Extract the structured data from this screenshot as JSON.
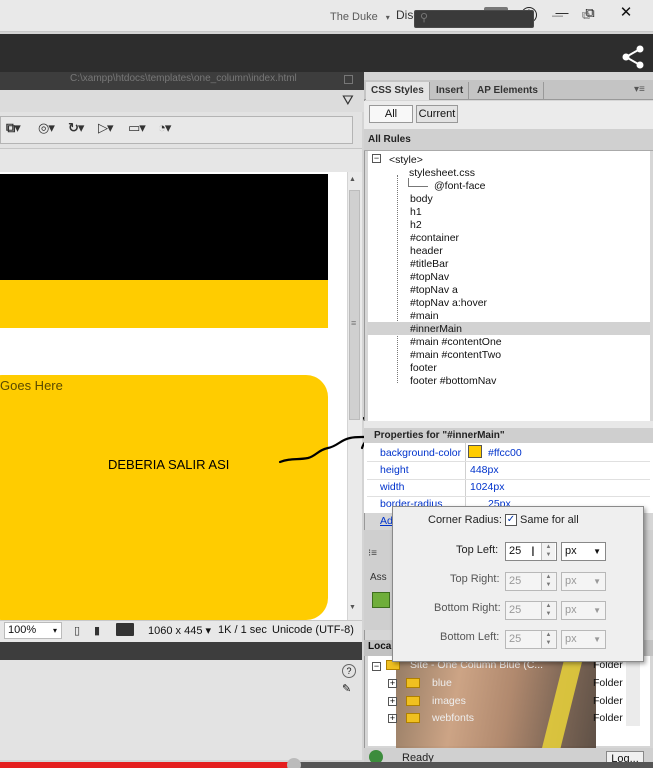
{
  "os_bar": {
    "workspace": "Diseño",
    "info_glyph": "i",
    "min_glyph": "—",
    "max_glyph": "⧉",
    "close_glyph": "✕",
    "sync_glyph": "⇆"
  },
  "app_bar": {
    "user": "The Duke"
  },
  "document": {
    "path": "C:\\xampp\\htdocs\\templates\\one_column\\index.html"
  },
  "design_view": {
    "placeholder_text": "Goes Here"
  },
  "status_bar": {
    "zoom": "100%",
    "window_size": "1060 x 445",
    "download": "1K / 1 sec",
    "encoding": "Unicode (UTF-8)"
  },
  "annotation": "DEBERIA SALIR ASI",
  "panel": {
    "tabs": [
      "CSS Styles",
      "Insert",
      "AP Elements"
    ],
    "buttons": {
      "all": "All",
      "current": "Current"
    },
    "section_label": "All Rules",
    "rules": [
      "<style>",
      "stylesheet.css",
      "@font-face",
      "body",
      "h1",
      "h2",
      "#container",
      "header",
      "#titleBar",
      "#topNav",
      "#topNav a",
      "#topNav a:hover",
      "#main",
      "#innerMain",
      "#main #contentOne",
      "#main #contentTwo",
      "footer",
      "footer #bottomNav"
    ],
    "selected_rule": "#innerMain",
    "properties_title": "Properties for \"#innerMain\"",
    "properties": [
      {
        "name": "background-color",
        "value": "#ffcc00"
      },
      {
        "name": "height",
        "value": "448px"
      },
      {
        "name": "width",
        "value": "1024px"
      },
      {
        "name": "border-radius",
        "value": "25px"
      }
    ],
    "add_property": "Add Property",
    "assets_label": "Ass"
  },
  "corner_radius_popup": {
    "title": "Corner Radius:",
    "same_for_all": "Same for all",
    "same_checked": true,
    "rows": [
      {
        "label": "Top Left:",
        "value": "25",
        "unit": "px",
        "enabled": true
      },
      {
        "label": "Top Right:",
        "value": "25",
        "unit": "px",
        "enabled": false
      },
      {
        "label": "Bottom Right:",
        "value": "25",
        "unit": "px",
        "enabled": false
      },
      {
        "label": "Bottom Left:",
        "value": "25",
        "unit": "px",
        "enabled": false
      }
    ]
  },
  "files": {
    "tab": "Loca",
    "rows": [
      {
        "name": "Site - One Column Blue (C...",
        "type": "Folder"
      },
      {
        "name": "blue",
        "type": "Folder"
      },
      {
        "name": "images",
        "type": "Folder"
      },
      {
        "name": "webfonts",
        "type": "Folder"
      }
    ]
  },
  "bottom_status": {
    "ready": "Ready",
    "log": "Log..."
  },
  "video": {
    "progress_fraction": 0.45
  },
  "colors": {
    "yellow": "#ffcc00",
    "link_blue": "#0033cc",
    "progress_red": "#e41e1e"
  }
}
